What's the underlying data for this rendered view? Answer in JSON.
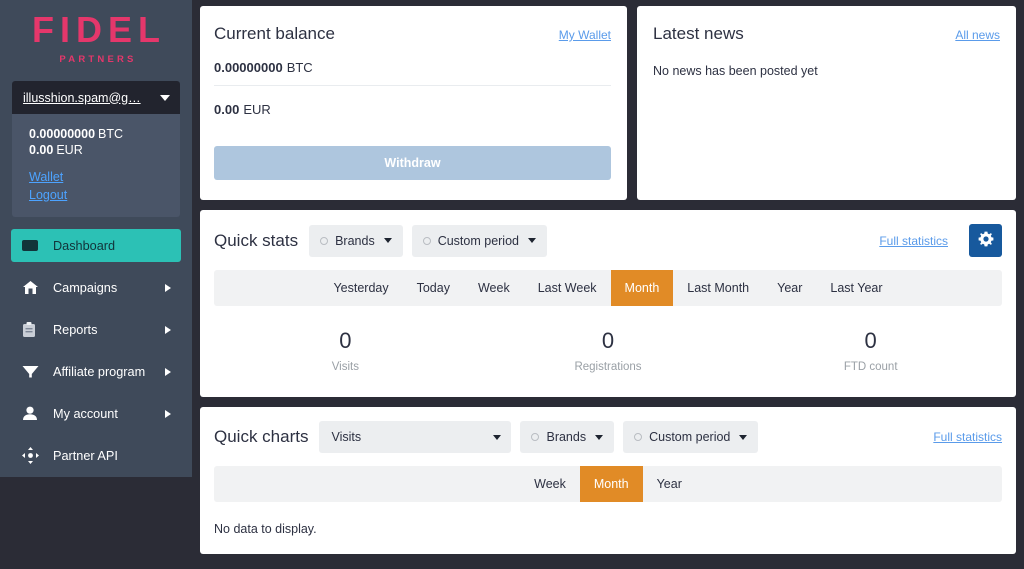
{
  "sidebar": {
    "logo": {
      "main": "FIDEL",
      "sub": "PARTNERS"
    },
    "account": {
      "email": "illusshion.spam@g…",
      "balances": [
        {
          "amount": "0.00000000",
          "currency": "BTC"
        },
        {
          "amount": "0.00",
          "currency": "EUR"
        }
      ],
      "links": [
        {
          "label": "Wallet",
          "name": "wallet-link"
        },
        {
          "label": "Logout",
          "name": "logout-link"
        }
      ]
    },
    "items": [
      {
        "label": "Dashboard",
        "icon": "dashboard-icon",
        "active": true,
        "has_arrow": false
      },
      {
        "label": "Campaigns",
        "icon": "home-icon",
        "active": false,
        "has_arrow": true
      },
      {
        "label": "Reports",
        "icon": "clipboard-icon",
        "active": false,
        "has_arrow": true
      },
      {
        "label": "Affiliate program",
        "icon": "funnel-icon",
        "active": false,
        "has_arrow": true
      },
      {
        "label": "My account",
        "icon": "user-icon",
        "active": false,
        "has_arrow": true
      },
      {
        "label": "Partner API",
        "icon": "move-icon",
        "active": false,
        "has_arrow": false
      }
    ]
  },
  "balance_card": {
    "title": "Current balance",
    "wallet_link": "My Wallet",
    "btc_amount": "0.00000000",
    "btc_unit": "BTC",
    "eur_amount": "0.00",
    "eur_unit": "EUR",
    "withdraw_label": "Withdraw"
  },
  "news_card": {
    "title": "Latest news",
    "all_news_link": "All news",
    "empty_text": "No news has been posted yet"
  },
  "quick_stats": {
    "title": "Quick stats",
    "brands_filter": "Brands",
    "period_filter": "Custom period",
    "full_statistics_link": "Full statistics",
    "settings_icon": "gear-icon",
    "tabs": [
      {
        "label": "Yesterday",
        "active": false
      },
      {
        "label": "Today",
        "active": false
      },
      {
        "label": "Week",
        "active": false
      },
      {
        "label": "Last Week",
        "active": false
      },
      {
        "label": "Month",
        "active": true
      },
      {
        "label": "Last Month",
        "active": false
      },
      {
        "label": "Year",
        "active": false
      },
      {
        "label": "Last Year",
        "active": false
      }
    ],
    "stats": [
      {
        "value": "0",
        "label": "Visits"
      },
      {
        "value": "0",
        "label": "Registrations"
      },
      {
        "value": "0",
        "label": "FTD count"
      }
    ]
  },
  "quick_charts": {
    "title": "Quick charts",
    "metric_select": "Visits",
    "brands_filter": "Brands",
    "period_filter": "Custom period",
    "full_statistics_link": "Full statistics",
    "tabs": [
      {
        "label": "Week",
        "active": false
      },
      {
        "label": "Month",
        "active": true
      },
      {
        "label": "Year",
        "active": false
      }
    ],
    "empty_text": "No data to display."
  },
  "colors": {
    "brand_pink": "#e5376b",
    "sidebar_bg": "#3f4a5a",
    "active_teal": "#2cc1b5",
    "tab_orange": "#e18b26",
    "link_blue": "#5a9bea",
    "gear_blue": "#17599d",
    "withdraw_blue": "#aec6de",
    "page_bg": "#2b2c36"
  }
}
